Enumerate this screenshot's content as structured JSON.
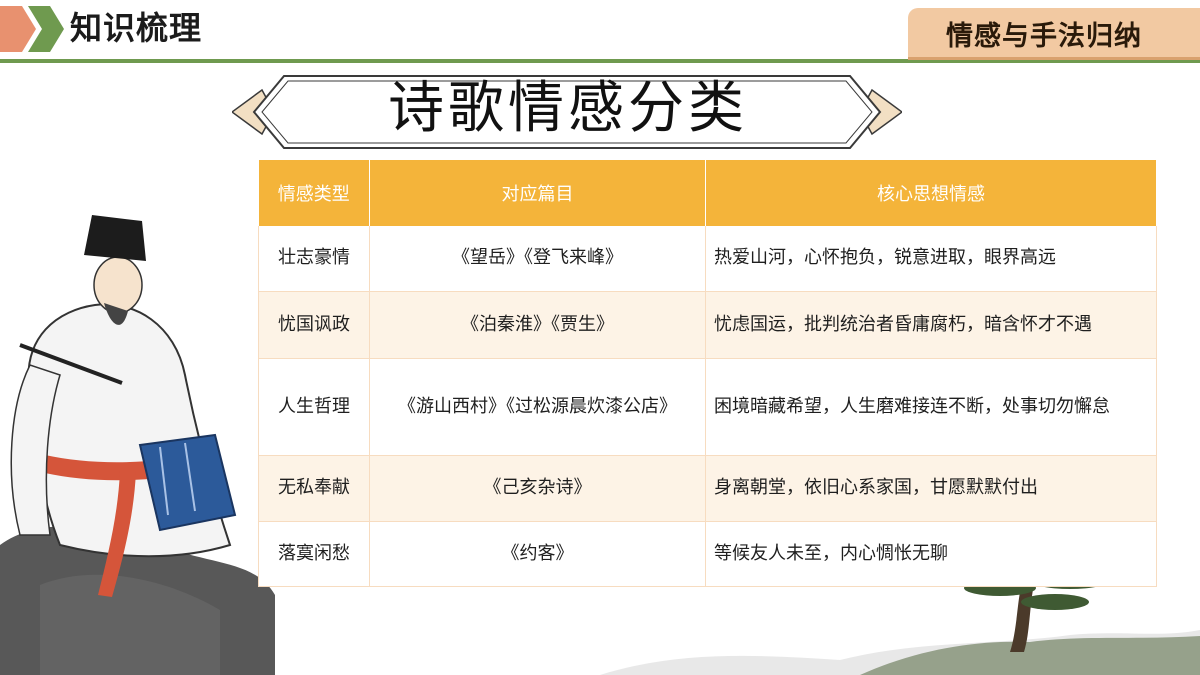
{
  "header": {
    "section_title": "知识梳理",
    "topic_tag": "情感与手法归纳"
  },
  "banner": {
    "title": "诗歌情感分类"
  },
  "table": {
    "columns": [
      "情感类型",
      "对应篇目",
      "核心思想情感"
    ],
    "rows": [
      {
        "type": "壮志豪情",
        "works": "《望岳》《登飞来峰》",
        "emotion": "热爱山河，心怀抱负，锐意进取，眼界高远"
      },
      {
        "type": "忧国讽政",
        "works": "《泊秦淮》《贾生》",
        "emotion": "忧虑国运，批判统治者昏庸腐朽，暗含怀才不遇"
      },
      {
        "type": "人生哲理",
        "works": "《游山西村》《过松源晨炊漆公店》",
        "emotion": "困境暗藏希望，人生磨难接连不断，处事切勿懈怠"
      },
      {
        "type": "无私奉献",
        "works": "《己亥杂诗》",
        "emotion": "身离朝堂，依旧心系家国，甘愿默默付出"
      },
      {
        "type": "落寞闲愁",
        "works": "《约客》",
        "emotion": "等候友人未至，内心惆怅无聊"
      }
    ]
  },
  "colors": {
    "header_green": "#6f9a4f",
    "chevron_salmon": "#e8916f",
    "tag_peach": "#f2c9a2",
    "table_header": "#f4b43a",
    "row_alt": "#fdf3e6",
    "border": "#f7dcc0"
  },
  "decorations": {
    "left": "poet-illustration",
    "bottom_right": "pine-tree-landscape"
  }
}
